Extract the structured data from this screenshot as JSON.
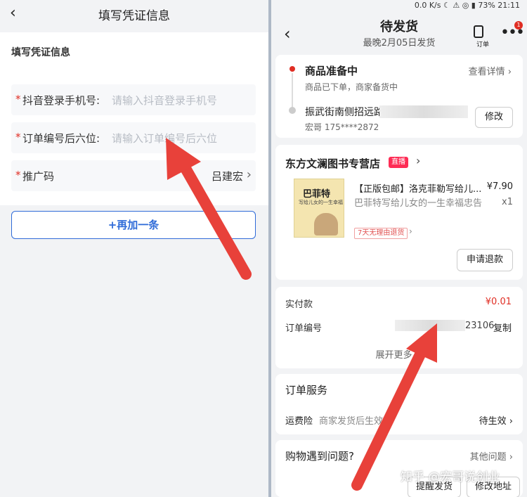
{
  "left": {
    "nav_title": "填写凭证信息",
    "section_title": "填写凭证信息",
    "rows": [
      {
        "label": "抖音登录手机号:",
        "placeholder": "请输入抖音登录手机号"
      },
      {
        "label": "订单编号后六位:",
        "placeholder": "请输入订单编号后六位"
      },
      {
        "label": "推广码",
        "value": "吕建宏"
      }
    ],
    "add_label": "+再加一条"
  },
  "right": {
    "status": "0.0 K/s ☾ ⚠ ◎ ▮ 73% 21:11",
    "title": "待发货",
    "subtitle": "最晚2月05日发货",
    "order_icon_label": "订单",
    "badge": "1",
    "progress": {
      "state": "商品准备中",
      "state_desc": "商品已下单，商家备货中",
      "details": "查看详情",
      "address": "振武街南侧招远路",
      "phone": "宏哥 175****2872",
      "edit": "修改"
    },
    "shop": {
      "name": "东方文澜图书专营店",
      "live": "直播",
      "book_title": "巴菲特",
      "book_subtitle": "写给儿女的一生幸福",
      "product_title": "【正版包邮】洛克菲勒写给儿...",
      "product_sub": "巴菲特写给儿女的一生幸福忠告",
      "price": "¥7.90",
      "qty": "x1",
      "tag": "7天无理由退货",
      "refund": "申请退款"
    },
    "payment": {
      "paid_label": "实付款",
      "paid_value": "¥0.01",
      "order_label": "订单编号",
      "order_tail": "23106",
      "copy": "复制",
      "expand": "展开更多"
    },
    "service": {
      "title": "订单服务",
      "item_label": "运费险",
      "item_sub": "商家发货后生效",
      "item_value": "待生效"
    },
    "help": {
      "title": "购物遇到问题?",
      "other": "其他问题",
      "remind": "提醒发货",
      "modify": "修改地址"
    }
  },
  "watermark": "知乎 @宏哥说创业",
  "colors": {
    "accent": "#2f6bd8",
    "red": "#e02e24",
    "arrow": "#e8413a"
  }
}
